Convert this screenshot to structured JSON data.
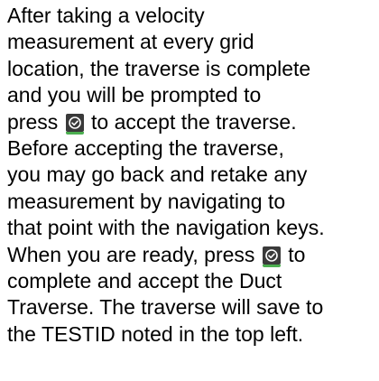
{
  "document": {
    "lines": [
      "After taking a velocity",
      "measurement at every grid",
      "location, the traverse is complete",
      "and you will be prompted to",
      "press",
      "to accept the traverse.",
      "Before accepting the traverse,",
      "you may go back and retake any",
      "measurement by navigating to",
      "that point with the navigation keys.",
      "When you are ready, press",
      "to",
      "complete and accept the Duct",
      "Traverse. The traverse will save to",
      "the TESTID noted in the top left."
    ],
    "accept_icon": "checkmark-circle-icon",
    "icon_bg_color": "#3a3a3a",
    "icon_underline_color": "#4caf50"
  }
}
